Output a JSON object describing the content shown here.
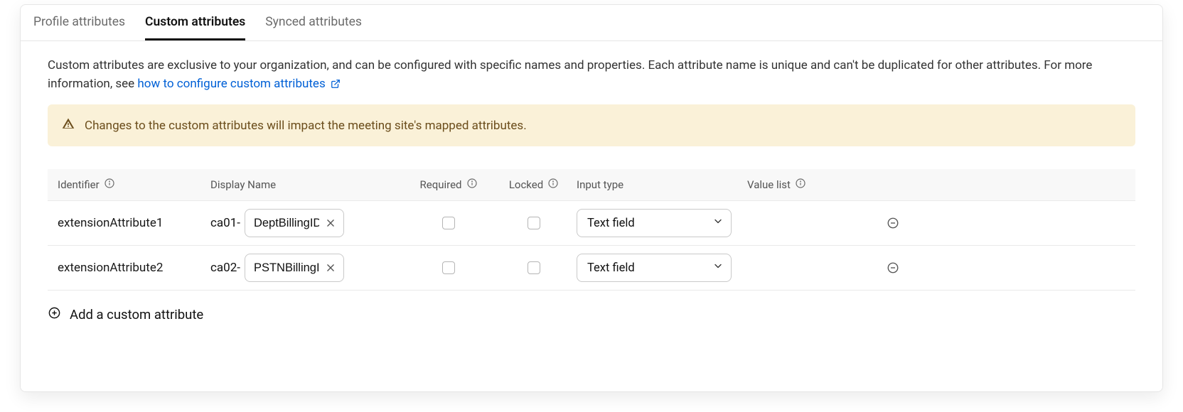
{
  "tabs": [
    {
      "label": "Profile attributes",
      "active": false
    },
    {
      "label": "Custom attributes",
      "active": true
    },
    {
      "label": "Synced attributes",
      "active": false
    }
  ],
  "description": {
    "text": "Custom attributes are exclusive to your organization, and can be configured with specific names and properties. Each attribute name is unique and can't be duplicated for other attributes. For more information, see ",
    "link_text": "how to configure custom attributes"
  },
  "banner": {
    "text": "Changes to the custom attributes will impact the meeting site's mapped attributes."
  },
  "columns": {
    "identifier": "Identifier",
    "display_name": "Display Name",
    "required": "Required",
    "locked": "Locked",
    "input_type": "Input type",
    "value_list": "Value list"
  },
  "rows": [
    {
      "identifier": "extensionAttribute1",
      "prefix": "ca01-",
      "display_name": "DeptBillingID",
      "required": false,
      "locked": false,
      "input_type": "Text field",
      "value_list": ""
    },
    {
      "identifier": "extensionAttribute2",
      "prefix": "ca02-",
      "display_name": "PSTNBillingID",
      "required": false,
      "locked": false,
      "input_type": "Text field",
      "value_list": ""
    }
  ],
  "add_button": {
    "label": "Add a custom attribute"
  }
}
